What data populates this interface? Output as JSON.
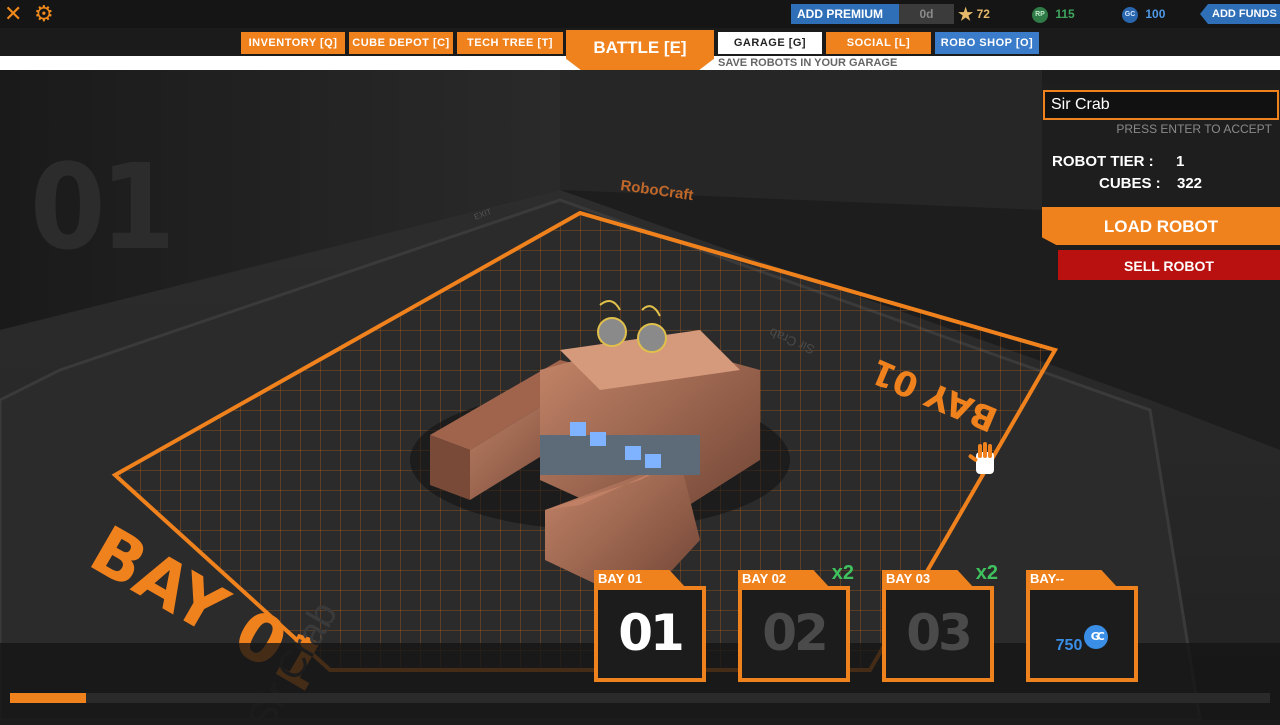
{
  "topbar": {
    "add_premium": "ADD PREMIUM",
    "premium_days": "0d",
    "stars": "72",
    "rp_label": "RP",
    "rp": "115",
    "gc_label": "GC",
    "gc": "100",
    "add_funds": "ADD FUNDS"
  },
  "nav": {
    "inventory": "INVENTORY [Q]",
    "cube_depot": "CUBE DEPOT [C]",
    "tech_tree": "TECH TREE [T]",
    "battle": "BATTLE [E]",
    "garage": "GARAGE [G]",
    "social": "SOCIAL [L]",
    "robo_shop": "ROBO SHOP [O]",
    "save_hint": "SAVE ROBOTS IN YOUR GARAGE"
  },
  "scene": {
    "big_bay_number": "01",
    "floor_label": "BAY 01",
    "wall_logo": "RoboCraft",
    "robot_floor_name": "Sir Crab",
    "exit_sign": "EXIT"
  },
  "panel": {
    "robot_name": "Sir Crab",
    "enter_hint": "PRESS ENTER TO ACCEPT",
    "tier_label": "ROBOT TIER :",
    "tier_value": "1",
    "cubes_label": "CUBES :",
    "cubes_value": "322",
    "load_robot": "LOAD ROBOT",
    "sell_robot": "SELL ROBOT"
  },
  "bays": [
    {
      "header_prefix": "BAY",
      "header_num": "01",
      "number": "01",
      "multiplier": "",
      "state": "active"
    },
    {
      "header_prefix": "BAY",
      "header_num": "02",
      "number": "02",
      "multiplier": "x2",
      "state": "inactive"
    },
    {
      "header_prefix": "BAY",
      "header_num": "03",
      "number": "03",
      "multiplier": "x2",
      "state": "inactive"
    },
    {
      "header_prefix": "BAY",
      "header_num": "--",
      "price": "750",
      "price_icon": "GC",
      "multiplier": "",
      "state": "locked"
    }
  ],
  "progress": {
    "fraction": 0.06
  },
  "colors": {
    "accent": "#f0821e",
    "blue": "#3a7cc9",
    "sell": "#b8110f",
    "multiplier": "#3fc25e"
  }
}
